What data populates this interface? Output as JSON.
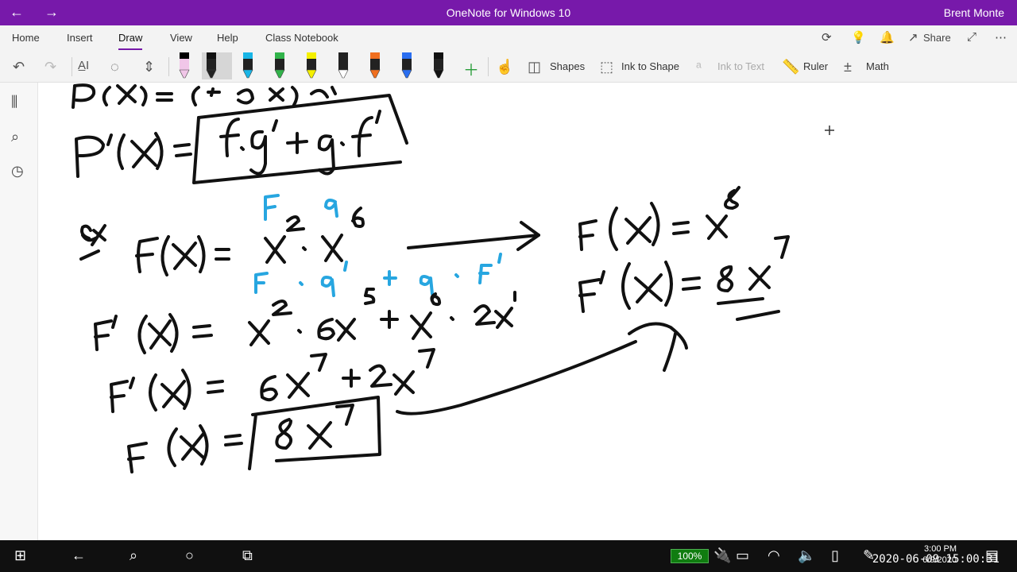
{
  "titlebar": {
    "title": "OneNote for Windows 10",
    "user": "Brent Monte",
    "back_icon": "back-arrow-icon",
    "forward_icon": "forward-arrow-icon"
  },
  "menu": {
    "tabs": [
      "Home",
      "Insert",
      "Draw",
      "View",
      "Help",
      "Class Notebook"
    ],
    "active": "Draw",
    "share_label": "Share"
  },
  "toolbar": {
    "shapes_label": "Shapes",
    "ink_to_shape_label": "Ink to Shape",
    "ink_to_text_label": "Ink to Text",
    "ruler_label": "Ruler",
    "math_label": "Math",
    "pens": [
      {
        "color": "#000000",
        "tip": "#f1c6e8"
      },
      {
        "color": "#111111",
        "tip": "#222222"
      },
      {
        "color": "#19b5e6",
        "tip": "#19b5e6"
      },
      {
        "color": "#31b34a",
        "tip": "#31b34a"
      },
      {
        "color": "#f5f000",
        "tip": "#f5f000"
      },
      {
        "color": "#222222",
        "tip": "#ffffff"
      },
      {
        "color": "#f06f1f",
        "tip": "#f06f1f"
      },
      {
        "color": "#2a6ef0",
        "tip": "#2a6ef0"
      },
      {
        "color": "#111111",
        "tip": "#111111"
      }
    ]
  },
  "colors": {
    "accent": "#7719aa",
    "ink_black": "#111111",
    "ink_blue": "#27a6e0"
  },
  "taskbar": {
    "battery": "100%",
    "time": "3:00 PM",
    "date": "6/9/2020",
    "timestamp": "2020-06-09 15:00:31"
  }
}
